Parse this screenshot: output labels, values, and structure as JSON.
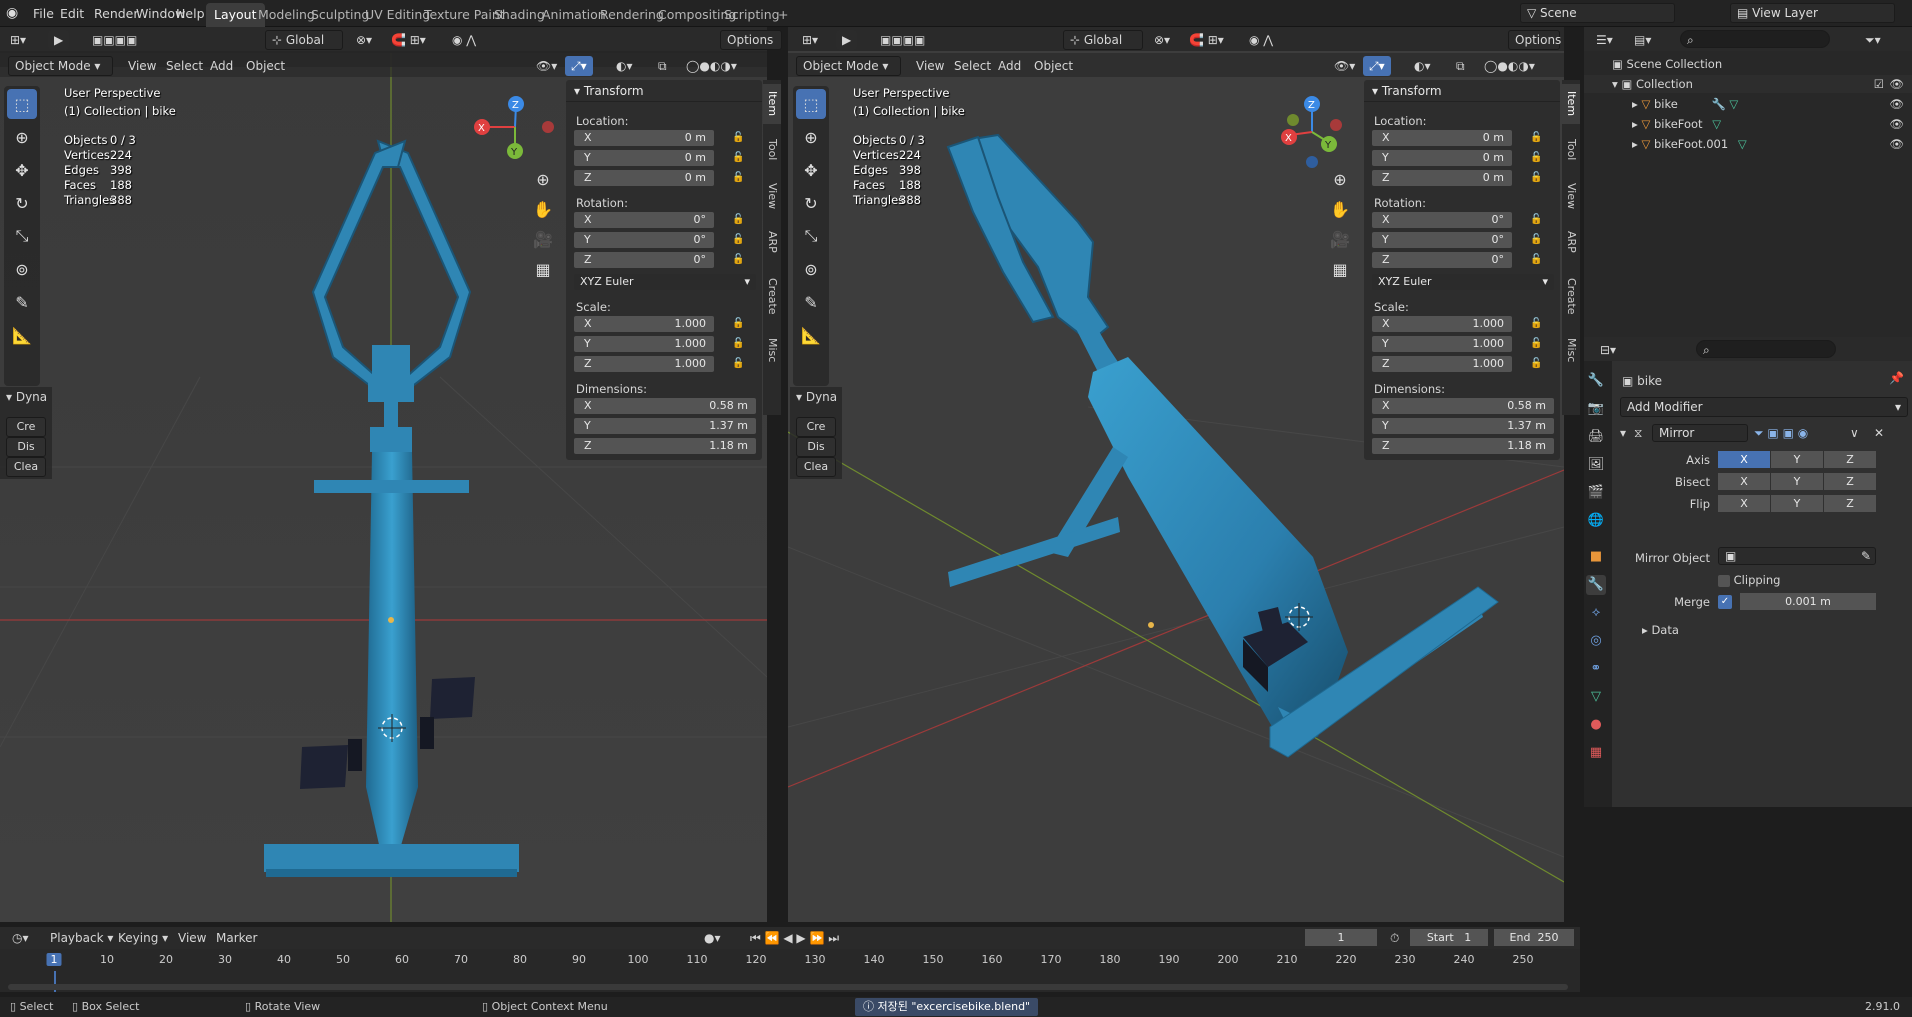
{
  "topbar": {
    "menus": [
      "File",
      "Edit",
      "Render",
      "Window",
      "Help"
    ],
    "workspaces": [
      "Layout",
      "Modeling",
      "Sculpting",
      "UV Editing",
      "Texture Paint",
      "Shading",
      "Animation",
      "Rendering",
      "Compositing",
      "Scripting"
    ],
    "add_tab": "+",
    "scene": "Scene",
    "view_layer": "View Layer"
  },
  "viewport_left": {
    "mode": "Object Mode",
    "view": "View",
    "select": "Select",
    "add": "Add",
    "object": "Object",
    "orientation": "Global",
    "options": "Options",
    "perspective": "User Perspective",
    "collection": "(1) Collection | bike",
    "stats": [
      {
        "k": "Objects",
        "v": "0 / 3"
      },
      {
        "k": "Vertices",
        "v": "224"
      },
      {
        "k": "Edges",
        "v": "398"
      },
      {
        "k": "Faces",
        "v": "188"
      },
      {
        "k": "Triangles",
        "v": "388"
      }
    ],
    "dyna": {
      "title": "Dyna",
      "b1": "Cre",
      "b2": "Dis",
      "b3": "Clea"
    },
    "gizmo": {
      "x": "X",
      "y": "Y",
      "z": "Z"
    }
  },
  "viewport_right": {
    "mode": "Object Mode",
    "view": "View",
    "select": "Select",
    "add": "Add",
    "object": "Object",
    "orientation": "Global",
    "options": "Options",
    "perspective": "User Perspective",
    "collection": "(1) Collection | bike",
    "stats": [
      {
        "k": "Objects",
        "v": "0 / 3"
      },
      {
        "k": "Vertices",
        "v": "224"
      },
      {
        "k": "Edges",
        "v": "398"
      },
      {
        "k": "Faces",
        "v": "188"
      },
      {
        "k": "Triangles",
        "v": "388"
      }
    ],
    "dyna": {
      "title": "Dyna",
      "b1": "Cre",
      "b2": "Dis",
      "b3": "Clea"
    },
    "gizmo": {
      "x": "X",
      "y": "Y",
      "z": "Z"
    }
  },
  "transform": {
    "title": "Transform",
    "location_label": "Location:",
    "rotation_label": "Rotation:",
    "scale_label": "Scale:",
    "dimensions_label": "Dimensions:",
    "axes": [
      "X",
      "Y",
      "Z"
    ],
    "location": [
      "0 m",
      "0 m",
      "0 m"
    ],
    "rotation": [
      "0°",
      "0°",
      "0°"
    ],
    "rotation_mode": "XYZ Euler",
    "scale": [
      "1.000",
      "1.000",
      "1.000"
    ],
    "dimensions": [
      "0.58 m",
      "1.37 m",
      "1.18 m"
    ]
  },
  "npanel_tabs": [
    "Item",
    "Tool",
    "View",
    "ARP",
    "Create",
    "Misc"
  ],
  "outliner": {
    "scene_collection": "Scene Collection",
    "collection": "Collection",
    "items": [
      "bike",
      "bikeFoot",
      "bikeFoot.001"
    ]
  },
  "properties": {
    "object_name": "bike",
    "add_modifier": "Add Modifier",
    "modifier_name": "Mirror",
    "axis_label": "Axis",
    "bisect_label": "Bisect",
    "flip_label": "Flip",
    "xyz": [
      "X",
      "Y",
      "Z"
    ],
    "mirror_object_label": "Mirror Object",
    "clipping_label": "Clipping",
    "merge_label": "Merge",
    "merge_value": "0.001 m",
    "data_label": "Data"
  },
  "timeline": {
    "playback": "Playback",
    "keying": "Keying",
    "view": "View",
    "marker": "Marker",
    "current_frame": "1",
    "start_label": "Start",
    "start": "1",
    "end_label": "End",
    "end": "250",
    "ticks": [
      "1",
      "10",
      "20",
      "30",
      "40",
      "50",
      "60",
      "70",
      "80",
      "90",
      "100",
      "110",
      "120",
      "130",
      "140",
      "150",
      "160",
      "170",
      "180",
      "190",
      "200",
      "210",
      "220",
      "230",
      "240",
      "250"
    ]
  },
  "statusbar": {
    "select": "Select",
    "box_select": "Box Select",
    "rotate_view": "Rotate View",
    "context_menu": "Object Context Menu",
    "message": "저장된 \"excercisebike.blend\"",
    "version": "2.91.0"
  },
  "colors": {
    "accent": "#4772b3",
    "bike": "#2f86b4",
    "grid_red": "#9c3a3a",
    "grid_green": "#6f8a2e"
  }
}
